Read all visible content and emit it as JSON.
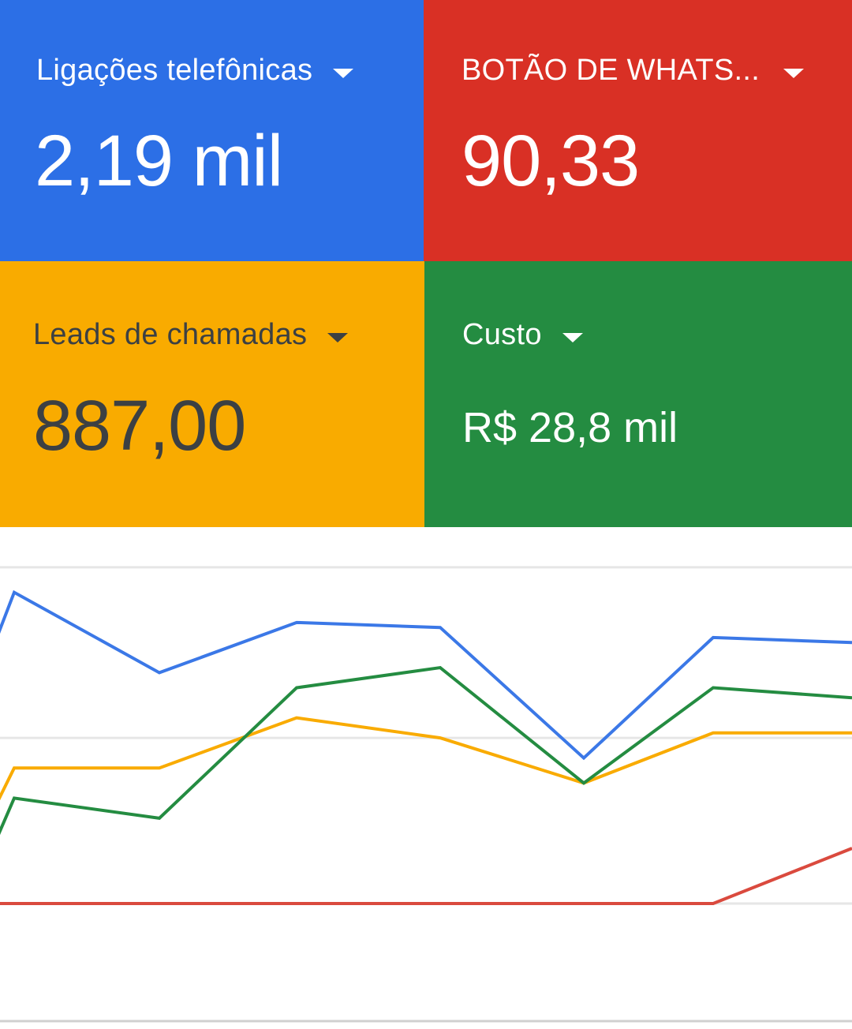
{
  "scorecards": [
    {
      "label": "Ligações telefônicas",
      "value": "2,19 mil",
      "bg": "#2C6FE6",
      "fg": "#FFFFFF"
    },
    {
      "label": "BOTÃO DE WHATS...",
      "value": "90,33",
      "bg": "#D93025",
      "fg": "#FFFFFF"
    },
    {
      "label": "Leads de chamadas",
      "value": "887,00",
      "bg": "#F9AB00",
      "fg": "#3C4043"
    },
    {
      "label": "Custo",
      "value": "R$ 28,8 mil",
      "bg": "#248C41",
      "fg": "#FFFFFF"
    }
  ],
  "icons": {
    "metric_dropdown": "caret-down-icon"
  },
  "chart_data": {
    "type": "line",
    "x": [
      0,
      1,
      2,
      3,
      4,
      5,
      6,
      7
    ],
    "ylim": [
      0,
      1
    ],
    "grid": true,
    "gridlines": [
      0.25,
      0.58,
      0.92
    ],
    "series": [
      {
        "color": "#3B78E7",
        "values": [
          0.87,
          0.71,
          0.81,
          0.8,
          0.54,
          0.78,
          0.77
        ]
      },
      {
        "color": "#F9AB00",
        "values": [
          0.52,
          0.52,
          0.62,
          0.58,
          0.49,
          0.59,
          0.59
        ]
      },
      {
        "color": "#248C41",
        "values": [
          0.46,
          0.42,
          0.68,
          0.72,
          0.49,
          0.68,
          0.66
        ]
      },
      {
        "color": "#DA4A3E",
        "values": [
          0.25,
          0.25,
          0.25,
          0.25,
          0.25,
          0.25,
          0.36
        ]
      }
    ]
  }
}
